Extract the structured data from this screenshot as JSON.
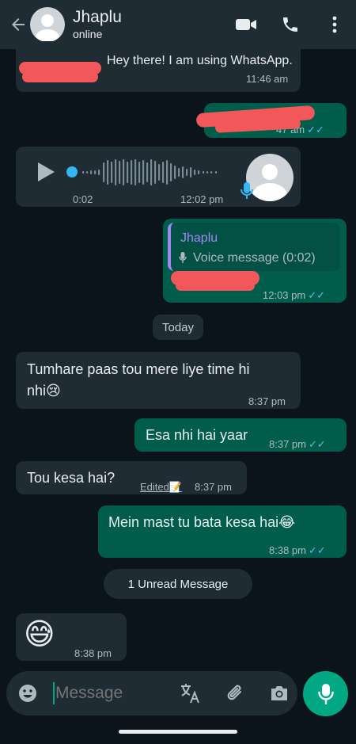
{
  "header": {
    "contact_name": "Jhaplu",
    "status": "online"
  },
  "messages": {
    "m1_text": "Hey there! I am using WhatsApp.",
    "m1_time": "11:46 am",
    "m2_time": "47 am",
    "voice_duration": "0:02",
    "voice_time": "12:02 pm",
    "reply_quote_name": "Jhaplu",
    "reply_quote_text": "Voice message (0:02)",
    "reply_time": "12:03 pm",
    "date_divider": "Today",
    "m5_text_line1": "Tumhare paas tou mere liye time hi",
    "m5_text_line2": "nhi",
    "m5_emoji": "😢",
    "m5_time": "8:37 pm",
    "m6_text": "Esa nhi hai yaar",
    "m6_time": "8:37 pm",
    "m7_text": "Tou kesa hai?",
    "m7_edited": "Edited",
    "m7_time": "8:37 pm",
    "m8_text": "Mein mast tu bata kesa hai",
    "m8_emoji": "😂",
    "m8_time": "8:38 pm",
    "unread_divider": "1 Unread Message",
    "m9_emoji": "😅",
    "m9_time": "8:38 pm"
  },
  "composer": {
    "placeholder": "Message"
  },
  "colors": {
    "header_bg": "#1f2c34",
    "incoming_bubble": "#1f2c34",
    "outgoing_bubble": "#005c4b",
    "accent_green": "#00a884",
    "read_ticks": "#53bdeb"
  }
}
